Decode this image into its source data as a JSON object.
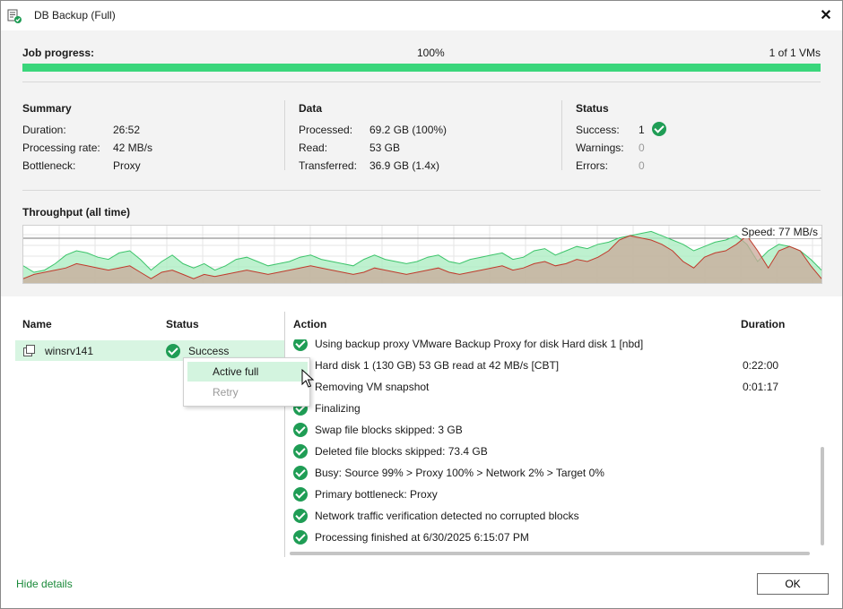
{
  "window": {
    "title": "DB Backup (Full)",
    "close_symbol": "✕"
  },
  "job_progress": {
    "label": "Job progress:",
    "percent_text": "100%",
    "percent_value": 100,
    "count_text": "1 of 1 VMs",
    "bar_color": "#3ad67b"
  },
  "summary": {
    "title": "Summary",
    "rows": [
      {
        "label": "Duration:",
        "value": "26:52"
      },
      {
        "label": "Processing rate:",
        "value": "42 MB/s"
      },
      {
        "label": "Bottleneck:",
        "value": "Proxy"
      }
    ]
  },
  "data_section": {
    "title": "Data",
    "rows": [
      {
        "label": "Processed:",
        "value": "69.2 GB (100%)"
      },
      {
        "label": "Read:",
        "value": "53 GB"
      },
      {
        "label": "Transferred:",
        "value": "36.9 GB (1.4x)"
      }
    ]
  },
  "status_section": {
    "title": "Status",
    "rows": [
      {
        "label": "Success:",
        "value": "1"
      },
      {
        "label": "Warnings:",
        "value": "0"
      },
      {
        "label": "Errors:",
        "value": "0"
      }
    ]
  },
  "throughput": {
    "title": "Throughput (all time)",
    "speed_text": "Speed: 77 MB/s",
    "colors": {
      "fill_green": "#a8ecbf",
      "line_green": "#3cc46a",
      "fill_brown": "#c9a89a",
      "line_red": "#c0392b"
    },
    "green_series": [
      16,
      10,
      12,
      18,
      26,
      30,
      28,
      24,
      22,
      28,
      30,
      22,
      12,
      20,
      26,
      18,
      14,
      18,
      12,
      16,
      22,
      24,
      20,
      16,
      18,
      20,
      24,
      26,
      22,
      20,
      18,
      16,
      22,
      26,
      22,
      20,
      18,
      20,
      24,
      26,
      20,
      18,
      22,
      24,
      26,
      28,
      22,
      24,
      30,
      32,
      26,
      30,
      34,
      32,
      36,
      38,
      42,
      44,
      46,
      48,
      44,
      40,
      36,
      30,
      34,
      38,
      40,
      44,
      36,
      20,
      30,
      36,
      34,
      30,
      22,
      12
    ],
    "red_series": [
      4,
      8,
      10,
      12,
      14,
      18,
      16,
      14,
      12,
      14,
      16,
      10,
      4,
      10,
      12,
      8,
      4,
      8,
      6,
      8,
      10,
      12,
      10,
      8,
      10,
      12,
      14,
      16,
      14,
      12,
      10,
      8,
      10,
      14,
      12,
      10,
      8,
      10,
      12,
      14,
      10,
      8,
      10,
      12,
      14,
      16,
      12,
      14,
      18,
      20,
      16,
      18,
      22,
      20,
      24,
      30,
      40,
      44,
      42,
      40,
      36,
      30,
      20,
      14,
      24,
      28,
      30,
      36,
      44,
      30,
      14,
      30,
      34,
      30,
      16,
      4
    ]
  },
  "lower": {
    "col_name": "Name",
    "col_status": "Status",
    "col_action": "Action",
    "col_duration": "Duration",
    "vm": {
      "name": "winsrv141",
      "status": "Success"
    },
    "actions": [
      {
        "text": "Using backup proxy VMware Backup Proxy for disk Hard disk 1 [nbd]",
        "duration": ""
      },
      {
        "text": "Hard disk 1 (130 GB) 53 GB read at 42 MB/s [CBT]",
        "duration": "0:22:00"
      },
      {
        "text": "Removing VM snapshot",
        "duration": "0:01:17"
      },
      {
        "text": "Finalizing",
        "duration": ""
      },
      {
        "text": "Swap file blocks skipped: 3 GB",
        "duration": ""
      },
      {
        "text": "Deleted file blocks skipped: 73.4 GB",
        "duration": ""
      },
      {
        "text": "Busy: Source 99% > Proxy 100% > Network 2% > Target 0%",
        "duration": ""
      },
      {
        "text": "Primary bottleneck: Proxy",
        "duration": ""
      },
      {
        "text": "Network traffic verification detected no corrupted blocks",
        "duration": ""
      },
      {
        "text": "Processing finished at 6/30/2025 6:15:07 PM",
        "duration": ""
      }
    ]
  },
  "context_menu": {
    "items": [
      {
        "label": "Active full",
        "state": "hover"
      },
      {
        "label": "Retry",
        "state": "disabled"
      }
    ]
  },
  "footer": {
    "hide_details": "Hide details",
    "ok_label": "OK"
  }
}
